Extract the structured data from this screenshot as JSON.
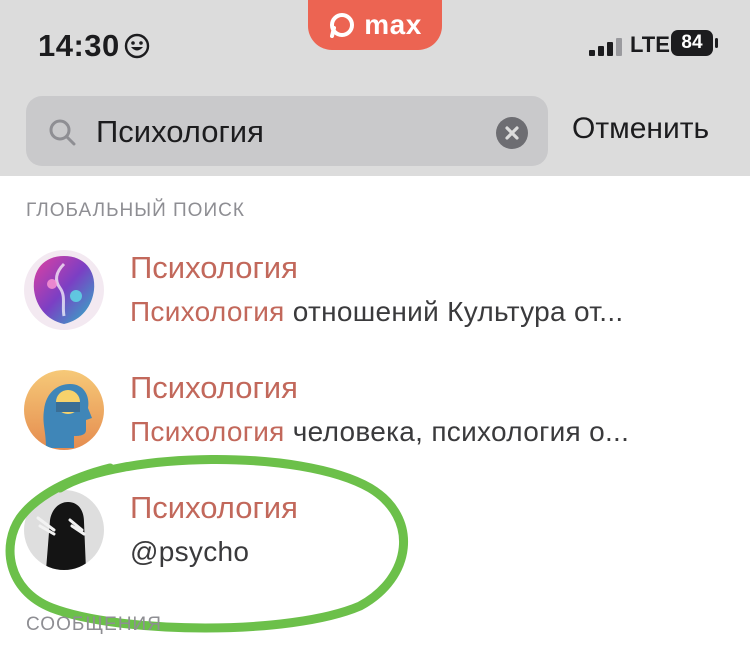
{
  "status_bar": {
    "time": "14:30",
    "app_name": "max",
    "network": "LTE",
    "battery": "84"
  },
  "search": {
    "query": "Психология",
    "cancel_label": "Отменить"
  },
  "sections": {
    "global_search": "ГЛОБАЛЬНЫЙ ПОИСК",
    "messages": "СООБЩЕНИЯ"
  },
  "results": [
    {
      "title": "Психология",
      "sub_highlight": "Психология",
      "sub_rest": " отношений Культура от...",
      "avatar_icon": "colorful-profiles-avatar"
    },
    {
      "title": "Психология",
      "sub_highlight": "Психология",
      "sub_rest": " человека, психология о...",
      "avatar_icon": "head-with-sun-avatar"
    },
    {
      "title": "Психология",
      "sub_highlight": "",
      "sub_rest": "@psycho",
      "avatar_icon": "figure-in-black-avatar"
    }
  ],
  "colors": {
    "accent": "#ec6452",
    "highlight_text": "#c2685b",
    "annotation": "#6cc04a"
  }
}
